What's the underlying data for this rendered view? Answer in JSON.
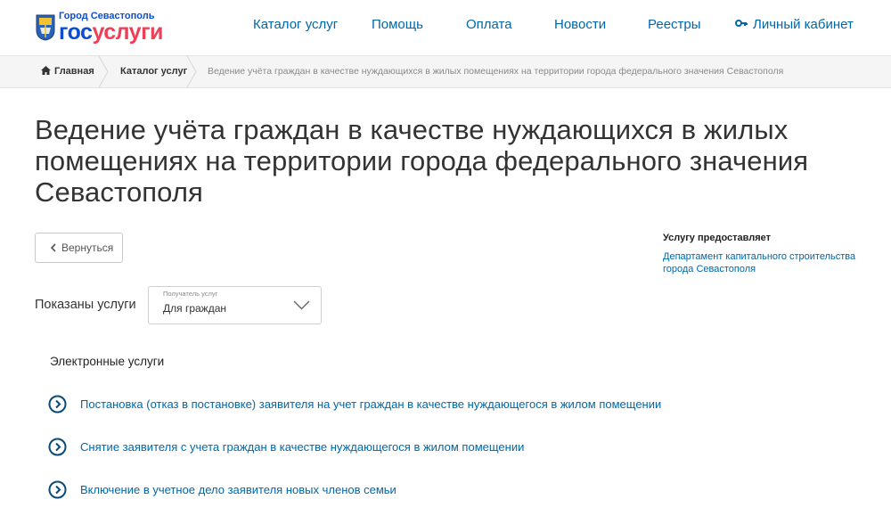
{
  "header": {
    "logo_city": "Город Севастополь",
    "logo_gos": "гос",
    "logo_uslugi": "услуги",
    "nav": [
      {
        "label": "Каталог услуг"
      },
      {
        "label": "Помощь"
      },
      {
        "label": "Оплата"
      },
      {
        "label": "Новости"
      },
      {
        "label": "Реестры"
      },
      {
        "label": "Личный кабинет",
        "icon": "key-icon"
      }
    ]
  },
  "breadcrumb": {
    "home": "Главная",
    "catalog": "Каталог услуг",
    "current": "Ведение учёта граждан в качестве нуждающихся в жилых помещениях на территории города федерального значения Севастополя"
  },
  "page": {
    "title": "Ведение учёта граждан в качестве нуждающихся в жилых помещениях на территории города федерального значения Севастополя",
    "back_label": "Вернуться"
  },
  "provider": {
    "label": "Услугу предоставляет",
    "name": "Департамент капитального строительства города Севастополя"
  },
  "filter": {
    "shown_label": "Показаны услуги",
    "select_caption": "Получатель услуг",
    "select_value": "Для граждан"
  },
  "services": {
    "section_title": "Электронные услуги",
    "items": [
      {
        "label": "Постановка (отказ в постановке) заявителя на учет граждан в качестве нуждающегося в жилом помещении"
      },
      {
        "label": "Снятие заявителя с учета граждан в качестве нуждающегося в жилом помещении"
      },
      {
        "label": "Включение в учетное дело заявителя новых членов семьи"
      }
    ]
  },
  "colors": {
    "link": "#0067a8",
    "brand_blue": "#0d4cd3",
    "brand_red": "#ee3f58",
    "icon_blue": "#0a4b78"
  }
}
